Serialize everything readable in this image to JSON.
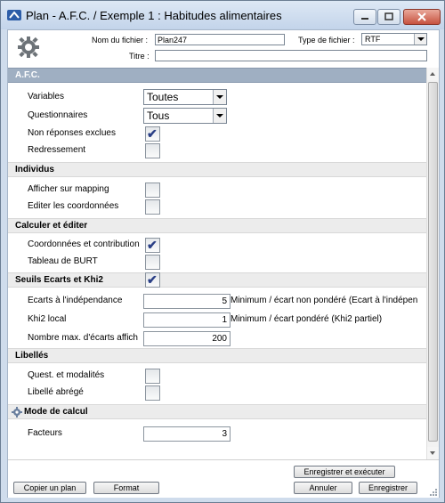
{
  "window": {
    "title": "Plan - A.F.C. / Exemple 1 : Habitudes alimentaires"
  },
  "header": {
    "filename_label": "Nom du fichier :",
    "filename_value": "Plan247",
    "filetype_label": "Type de fichier :",
    "filetype_value": "RTF",
    "title_label": "Titre :",
    "title_value": ""
  },
  "sections": {
    "afc": {
      "label": "A.F.C.",
      "variables_label": "Variables",
      "variables_value": "Toutes",
      "questionnaires_label": "Questionnaires",
      "questionnaires_value": "Tous",
      "non_reponses_label": "Non réponses exclues",
      "non_reponses_checked": true,
      "redressement_label": "Redressement",
      "redressement_checked": false
    },
    "individus": {
      "label": "Individus",
      "afficher_label": "Afficher sur mapping",
      "afficher_checked": false,
      "editer_label": "Editer les coordonnées",
      "editer_checked": false
    },
    "calculer": {
      "label": "Calculer et éditer",
      "coord_label": "Coordonnées et contribution",
      "coord_checked": true,
      "burt_label": "Tableau de BURT",
      "burt_checked": false
    },
    "seuils": {
      "label": "Seuils Ecarts et Khi2",
      "checked": true,
      "ecarts_label": "Ecarts à l'indépendance",
      "ecarts_value": "5",
      "ecarts_hint": "Minimum / écart non pondéré (Ecart à l'indépen",
      "khi2_label": "Khi2 local",
      "khi2_value": "1",
      "khi2_hint": "Minimum / écart pondéré (Khi2 partiel)",
      "nombre_label": "Nombre max. d'écarts affich",
      "nombre_value": "200"
    },
    "libelles": {
      "label": "Libellés",
      "quest_label": "Quest. et modalités",
      "quest_checked": false,
      "abrege_label": "Libellé abrégé",
      "abrege_checked": false
    },
    "mode": {
      "label": "Mode de calcul",
      "facteurs_label": "Facteurs",
      "facteurs_value": "3"
    }
  },
  "buttons": {
    "enregistrer_executer": "Enregistrer et exécuter",
    "copier_plan": "Copier un plan",
    "format": "Format",
    "annuler": "Annuler",
    "enregistrer": "Enregistrer"
  },
  "check_glyph": "✔",
  "colors": {
    "accent_section": "#9fafc2",
    "section_bg": "#ececec",
    "check": "#2a3f86",
    "close_button": "#c7523f"
  }
}
